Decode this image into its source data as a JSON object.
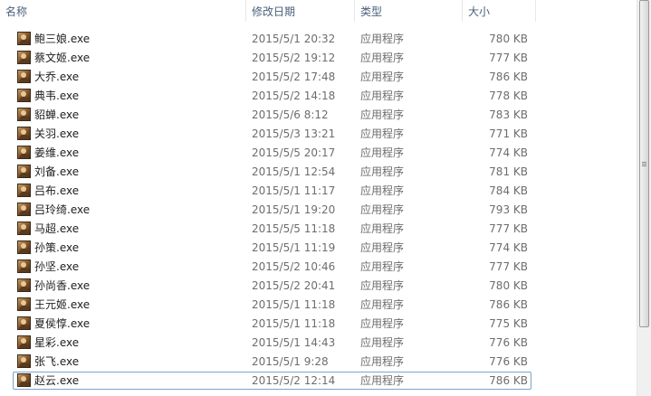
{
  "columns": {
    "name": "名称",
    "date": "修改日期",
    "type": "类型",
    "size": "大小",
    "sort_indicator": "ˆ"
  },
  "files": [
    {
      "name": "鲍三娘.exe",
      "date": "2015/5/1 20:32",
      "type": "应用程序",
      "size": "780 KB"
    },
    {
      "name": "蔡文姬.exe",
      "date": "2015/5/2 19:12",
      "type": "应用程序",
      "size": "777 KB"
    },
    {
      "name": "大乔.exe",
      "date": "2015/5/2 17:48",
      "type": "应用程序",
      "size": "786 KB"
    },
    {
      "name": "典韦.exe",
      "date": "2015/5/2 14:18",
      "type": "应用程序",
      "size": "778 KB"
    },
    {
      "name": "貂蝉.exe",
      "date": "2015/5/6 8:12",
      "type": "应用程序",
      "size": "783 KB"
    },
    {
      "name": "关羽.exe",
      "date": "2015/5/3 13:21",
      "type": "应用程序",
      "size": "771 KB"
    },
    {
      "name": "姜维.exe",
      "date": "2015/5/5 20:17",
      "type": "应用程序",
      "size": "774 KB"
    },
    {
      "name": "刘备.exe",
      "date": "2015/5/1 12:54",
      "type": "应用程序",
      "size": "781 KB"
    },
    {
      "name": "吕布.exe",
      "date": "2015/5/1 11:17",
      "type": "应用程序",
      "size": "784 KB"
    },
    {
      "name": "吕玲绮.exe",
      "date": "2015/5/1 19:20",
      "type": "应用程序",
      "size": "793 KB"
    },
    {
      "name": "马超.exe",
      "date": "2015/5/5 11:18",
      "type": "应用程序",
      "size": "777 KB"
    },
    {
      "name": "孙策.exe",
      "date": "2015/5/1 11:19",
      "type": "应用程序",
      "size": "774 KB"
    },
    {
      "name": "孙坚.exe",
      "date": "2015/5/2 10:46",
      "type": "应用程序",
      "size": "777 KB"
    },
    {
      "name": "孙尚香.exe",
      "date": "2015/5/2 20:41",
      "type": "应用程序",
      "size": "780 KB"
    },
    {
      "name": "王元姬.exe",
      "date": "2015/5/1 11:18",
      "type": "应用程序",
      "size": "786 KB"
    },
    {
      "name": "夏侯惇.exe",
      "date": "2015/5/1 11:18",
      "type": "应用程序",
      "size": "775 KB"
    },
    {
      "name": "星彩.exe",
      "date": "2015/5/1 14:43",
      "type": "应用程序",
      "size": "776 KB"
    },
    {
      "name": "张飞.exe",
      "date": "2015/5/1 9:28",
      "type": "应用程序",
      "size": "776 KB"
    },
    {
      "name": "赵云.exe",
      "date": "2015/5/2 12:14",
      "type": "应用程序",
      "size": "786 KB"
    }
  ],
  "focused_index": 18,
  "file_icon": "character-portrait-icon",
  "colors": {
    "header_text": "#4c607a",
    "focus_border": "#7da2ce"
  }
}
